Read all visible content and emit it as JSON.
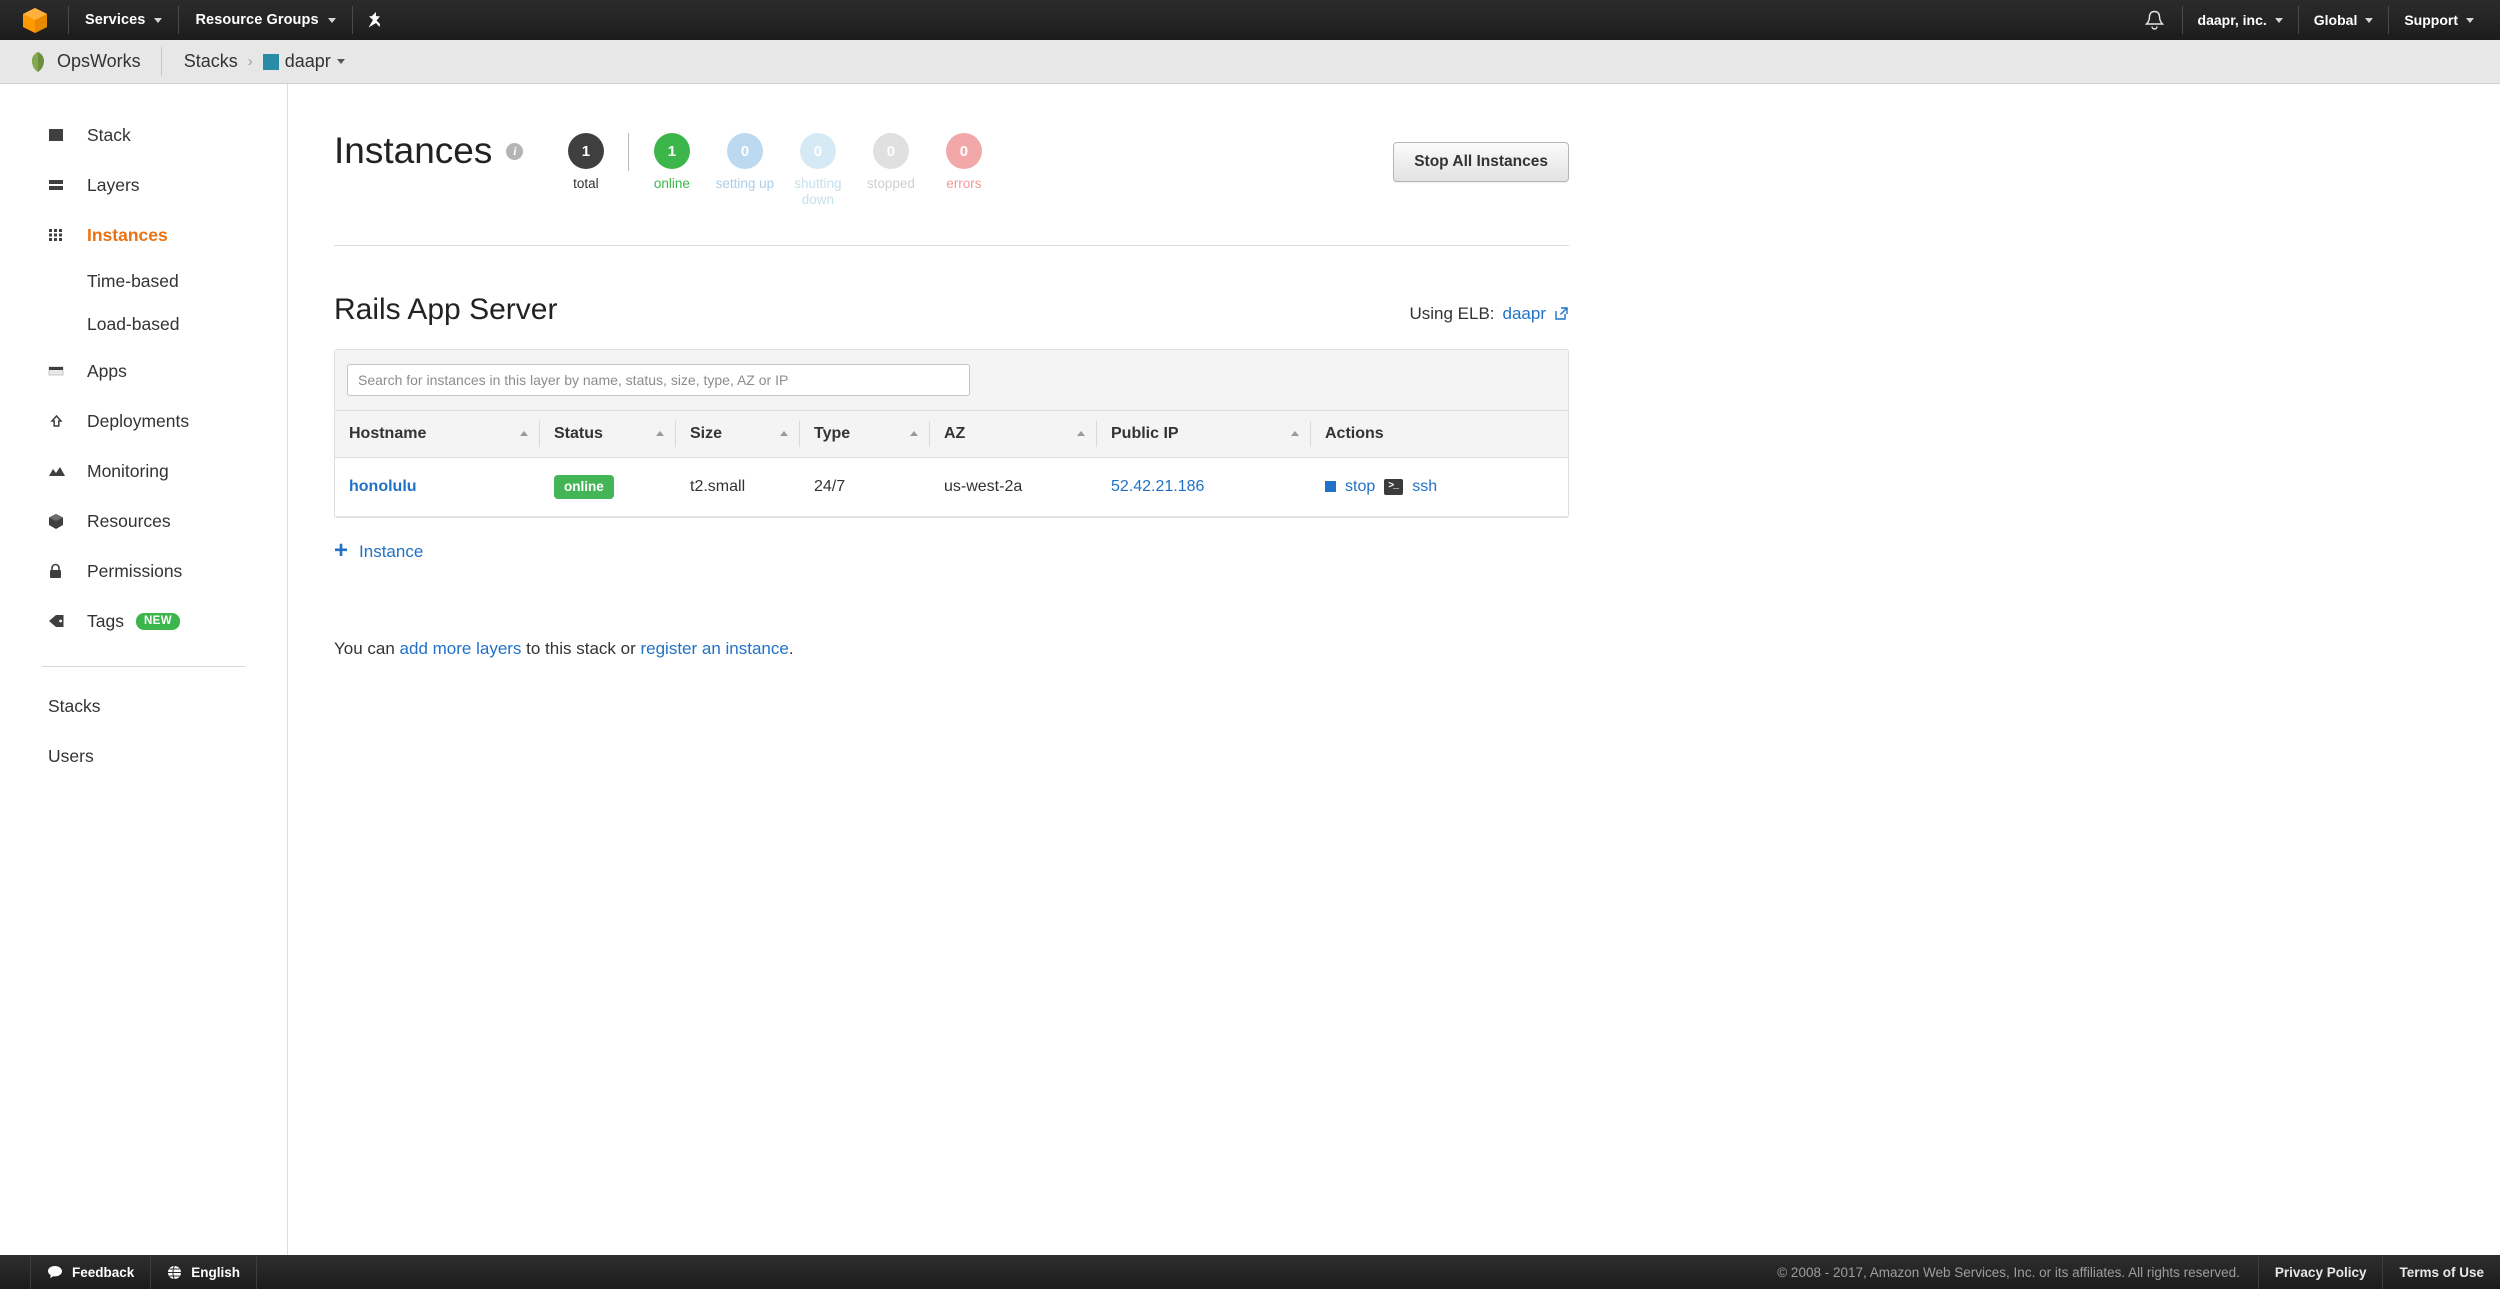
{
  "topnav": {
    "logo_icon": "aws-cube-icon",
    "services_label": "Services",
    "resource_groups_label": "Resource Groups",
    "pin_icon": "pin-icon",
    "bell_icon": "bell-notification-icon",
    "account_label": "daapr, inc.",
    "region_label": "Global",
    "support_label": "Support"
  },
  "breadcrumb": {
    "product_icon": "opsworks-icon",
    "product_label": "OpsWorks",
    "stacks_label": "Stacks",
    "separator": "›",
    "stack_name": "daapr",
    "stack_color": "#2a8ca4"
  },
  "sidebar": {
    "items": [
      {
        "label": "Stack",
        "icon": "square-icon",
        "active": false
      },
      {
        "label": "Layers",
        "icon": "layers-icon",
        "active": false
      },
      {
        "label": "Instances",
        "icon": "grid-dots-icon",
        "active": true
      },
      {
        "label": "Apps",
        "icon": "window-icon",
        "active": false
      },
      {
        "label": "Deployments",
        "icon": "deployments-arrow-icon",
        "active": false
      },
      {
        "label": "Monitoring",
        "icon": "mountain-chart-icon",
        "active": false
      },
      {
        "label": "Resources",
        "icon": "cube-icon",
        "active": false
      },
      {
        "label": "Permissions",
        "icon": "lock-icon",
        "active": false
      },
      {
        "label": "Tags",
        "icon": "tag-icon",
        "active": false,
        "badge": "NEW"
      }
    ],
    "subitems": [
      {
        "label": "Time-based"
      },
      {
        "label": "Load-based"
      }
    ],
    "footer_items": [
      {
        "label": "Stacks"
      },
      {
        "label": "Users"
      }
    ]
  },
  "page": {
    "title": "Instances",
    "info_icon": "info-icon",
    "stop_all_label": "Stop All Instances",
    "counters": [
      {
        "value": "1",
        "label": "total",
        "circle": "#3f3f3f",
        "text": "#333333"
      },
      {
        "value": "1",
        "label": "online",
        "circle": "#3cb54a",
        "text": "#3cb54a"
      },
      {
        "value": "0",
        "label": "setting up",
        "circle": "#bcd9f2",
        "text": "#a9cdea"
      },
      {
        "value": "0",
        "label": "shutting down",
        "circle": "#d6eaf5",
        "text": "#c5e0ee"
      },
      {
        "value": "0",
        "label": "stopped",
        "circle": "#e0e0e0",
        "text": "#cfcfcf"
      },
      {
        "value": "0",
        "label": "errors",
        "circle": "#f2a8a8",
        "text": "#ef9b9b"
      }
    ]
  },
  "layer": {
    "title": "Rails App Server",
    "elb_prefix": "Using ELB:",
    "elb_name": "daapr",
    "elb_external_icon": "external-link-icon"
  },
  "search": {
    "placeholder": "Search for instances in this layer by name, status, size, type, AZ or IP",
    "value": ""
  },
  "table": {
    "columns": [
      {
        "label": "Hostname",
        "sortable": true
      },
      {
        "label": "Status",
        "sortable": true
      },
      {
        "label": "Size",
        "sortable": true
      },
      {
        "label": "Type",
        "sortable": true
      },
      {
        "label": "AZ",
        "sortable": true
      },
      {
        "label": "Public IP",
        "sortable": true
      },
      {
        "label": "Actions",
        "sortable": false
      }
    ],
    "rows": [
      {
        "hostname": "honolulu",
        "status": "online",
        "status_color": "#44b556",
        "size": "t2.small",
        "type": "24/7",
        "az": "us-west-2a",
        "public_ip": "52.42.21.186",
        "action_stop": "stop",
        "action_ssh": "ssh",
        "stop_icon": "stop-square-icon",
        "ssh_icon": "terminal-icon"
      }
    ]
  },
  "add_instance": {
    "plus_icon": "plus-icon",
    "label": "Instance"
  },
  "help": {
    "prefix": "You can ",
    "link1": "add more layers",
    "middle": " to this stack or ",
    "link2": "register an instance",
    "suffix": "."
  },
  "footer": {
    "feedback_icon": "speech-bubble-icon",
    "feedback_label": "Feedback",
    "language_icon": "globe-icon",
    "language_label": "English",
    "copyright": "© 2008 - 2017, Amazon Web Services, Inc. or its affiliates. All rights reserved.",
    "privacy_label": "Privacy Policy",
    "terms_label": "Terms of Use"
  }
}
